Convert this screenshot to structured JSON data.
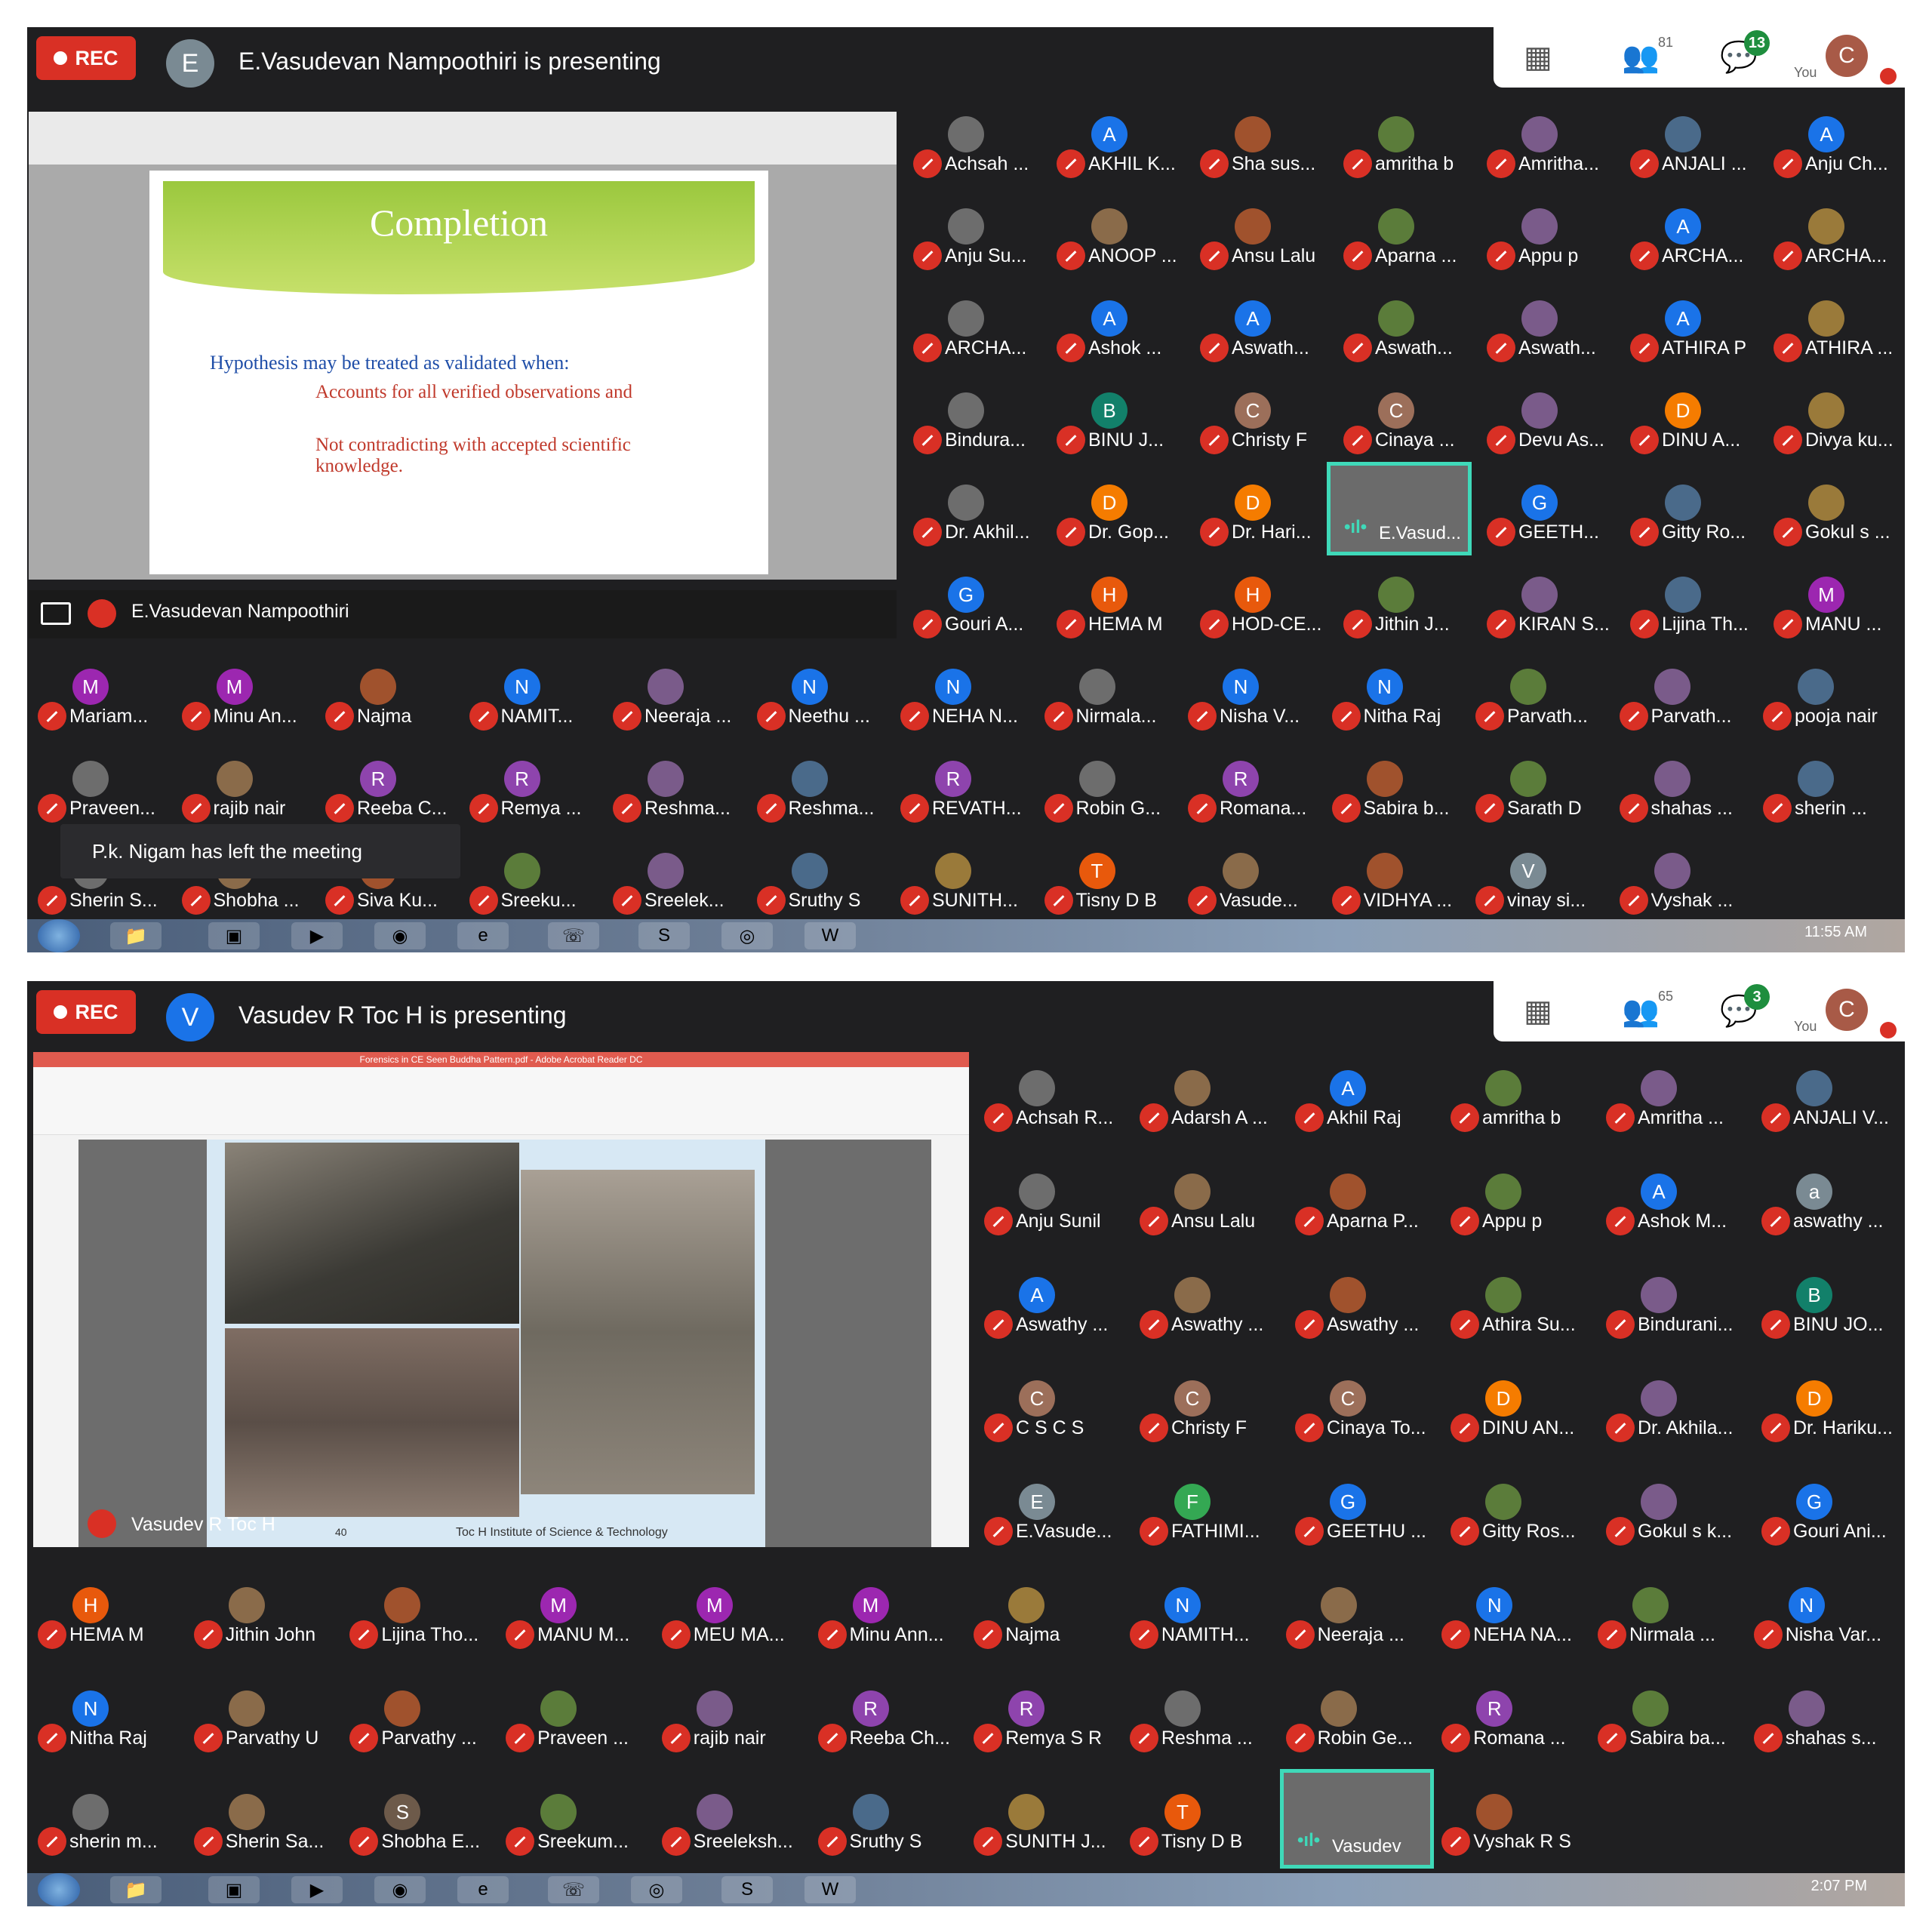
{
  "shot1": {
    "rec": "REC",
    "presenter_initial": "E",
    "presenter_color": "#7a8a93",
    "presenting_text": "E.Vasudevan Nampoothiri is presenting",
    "participant_count": "81",
    "chat_badge": "13",
    "you_label": "You",
    "user_initial": "C",
    "slide": {
      "title": "Completion",
      "bullet": "Hypothesis  may be  treated as validated  when:",
      "sub1": "Accounts for all verified observations and",
      "sub2": "Not contradicting with accepted scientific knowledge."
    },
    "present_label": "E.Vasudevan Nampoothiri",
    "toast": "P.k. Nigam has left the meeting",
    "clock": "11:55 AM",
    "highlight_name": "E.Vasud...",
    "rows": [
      [
        "Achsah ...",
        "AKHIL K...",
        "Sha sus...",
        "amritha b",
        "Amritha...",
        "ANJALI ...",
        "Anju Ch..."
      ],
      [
        "Anju Su...",
        "ANOOP ...",
        "Ansu Lalu",
        "Aparna ...",
        "Appu p",
        "ARCHA...",
        "ARCHA..."
      ],
      [
        "ARCHA...",
        "Ashok ...",
        "Aswath...",
        "Aswath...",
        "Aswath...",
        "ATHIRA P",
        "ATHIRA ..."
      ],
      [
        "Bindura...",
        "BINU J...",
        "Christy F",
        "Cinaya ...",
        "Devu As...",
        "DINU A...",
        "Divya ku..."
      ],
      [
        "Dr. Akhil...",
        "Dr. Gop...",
        "Dr. Hari...",
        "",
        "GEETH...",
        "Gitty Ro...",
        "Gokul s ..."
      ],
      [
        "Gouri A...",
        "HEMA M",
        "HOD-CE...",
        "Jithin J...",
        "KIRAN S...",
        "Lijina Th...",
        "MANU ..."
      ],
      [
        "Mariam...",
        "Minu An...",
        "Najma",
        "NAMIT...",
        "Neeraja ...",
        "Neethu ...",
        "NEHA N...",
        "Nirmala...",
        "Nisha V...",
        "Nitha Raj",
        "Parvath...",
        "Parvath...",
        "pooja nair"
      ],
      [
        "Praveen...",
        "rajib nair",
        "Reeba C...",
        "Remya ...",
        "Reshma...",
        "Reshma...",
        "REVATH...",
        "Robin G...",
        "Romana...",
        "Sabira b...",
        "Sarath D",
        "shahas ...",
        "sherin ..."
      ],
      [
        "Sherin S...",
        "Shobha ...",
        "Siva Ku...",
        "Sreeku...",
        "Sreelek...",
        "Sruthy S",
        "SUNITH...",
        "Tisny D B",
        "Vasude...",
        "VIDHYA ...",
        "vinay si...",
        "Vyshak ..."
      ]
    ],
    "initials": [
      [
        "",
        "A",
        "",
        "",
        "",
        "",
        "A"
      ],
      [
        "",
        "",
        "",
        "",
        "",
        "A",
        ""
      ],
      [
        "",
        "A",
        "A",
        "",
        "",
        "A",
        ""
      ],
      [
        "",
        "B",
        "C",
        "C",
        "",
        "D",
        ""
      ],
      [
        "",
        "D",
        "D",
        "",
        "G",
        "",
        ""
      ],
      [
        "G",
        "H",
        "H",
        "",
        "",
        "",
        "M"
      ],
      [
        "M",
        "M",
        "",
        "N",
        "",
        "N",
        "N",
        "",
        "N",
        "N",
        "",
        "",
        ""
      ],
      [
        "",
        "",
        "R",
        "R",
        "",
        "",
        "R",
        "",
        "R",
        "",
        "",
        "",
        ""
      ],
      [
        "",
        "",
        "",
        "",
        "",
        "",
        "",
        "T",
        "",
        "",
        "V",
        ""
      ]
    ]
  },
  "shot2": {
    "rec": "REC",
    "presenter_initial": "V",
    "presenter_color": "#1a73e8",
    "presenting_text": "Vasudev R Toc H is presenting",
    "participant_count": "65",
    "chat_badge": "3",
    "you_label": "You",
    "user_initial": "C",
    "app_title": "Forensics in CE Seen Buddha Pattern.pdf - Adobe Acrobat Reader DC",
    "footer_text": "Toc H Institute of Science & Technology",
    "page_num": "40",
    "present_label": "Vasudev R Toc H",
    "clock": "2:07 PM",
    "highlight_name": "Vasudev",
    "rows": [
      [
        "Achsah R...",
        "Adarsh A ...",
        "Akhil Raj",
        "amritha b",
        "Amritha ...",
        "ANJALI V..."
      ],
      [
        "Anju Sunil",
        "Ansu Lalu",
        "Aparna P...",
        "Appu p",
        "Ashok M...",
        "aswathy ..."
      ],
      [
        "Aswathy ...",
        "Aswathy ...",
        "Aswathy ...",
        "Athira Su...",
        "Bindurani...",
        "BINU JO..."
      ],
      [
        "C S C S",
        "Christy F",
        "Cinaya To...",
        "DINU AN...",
        "Dr. Akhila...",
        "Dr. Hariku..."
      ],
      [
        "E.Vasude...",
        "FATHIMI...",
        "GEETHU ...",
        "Gitty Ros...",
        "Gokul s k...",
        "Gouri Ani..."
      ],
      [
        "HEMA M",
        "Jithin John",
        "Lijina Tho...",
        "MANU M...",
        "MEU MA...",
        "Minu Ann...",
        "Najma",
        "NAMITH...",
        "Neeraja ...",
        "NEHA NA...",
        "Nirmala ...",
        "Nisha Var..."
      ],
      [
        "Nitha Raj",
        "Parvathy U",
        "Parvathy ...",
        "Praveen ...",
        "rajib nair",
        "Reeba Ch...",
        "Remya S R",
        "Reshma ...",
        "Robin Ge...",
        "Romana ...",
        "Sabira ba...",
        "shahas s..."
      ],
      [
        "sherin m...",
        "Sherin Sa...",
        "Shobha E...",
        "Sreekum...",
        "Sreeleksh...",
        "Sruthy S",
        "SUNITH J...",
        "Tisny D B",
        "",
        "Vyshak R S"
      ]
    ],
    "initials": [
      [
        "",
        "",
        "A",
        "",
        "",
        ""
      ],
      [
        "",
        "",
        "",
        "",
        "A",
        "a"
      ],
      [
        "A",
        "",
        "",
        "",
        "",
        "B"
      ],
      [
        "C",
        "C",
        "C",
        "D",
        "",
        "D"
      ],
      [
        "E",
        "F",
        "G",
        "",
        "",
        "G"
      ],
      [
        "H",
        "",
        "",
        "M",
        "M",
        "M",
        "",
        "N",
        "",
        "N",
        "",
        "N"
      ],
      [
        "N",
        "",
        "",
        "",
        "",
        "R",
        "R",
        "",
        "",
        "R",
        "",
        ""
      ],
      [
        "",
        "",
        "S",
        "",
        "",
        "",
        "",
        "T",
        "",
        ""
      ]
    ]
  },
  "colors": {
    "red": "#d93025",
    "teal": "#3fd9b9",
    "bg": "#1f1f21"
  }
}
